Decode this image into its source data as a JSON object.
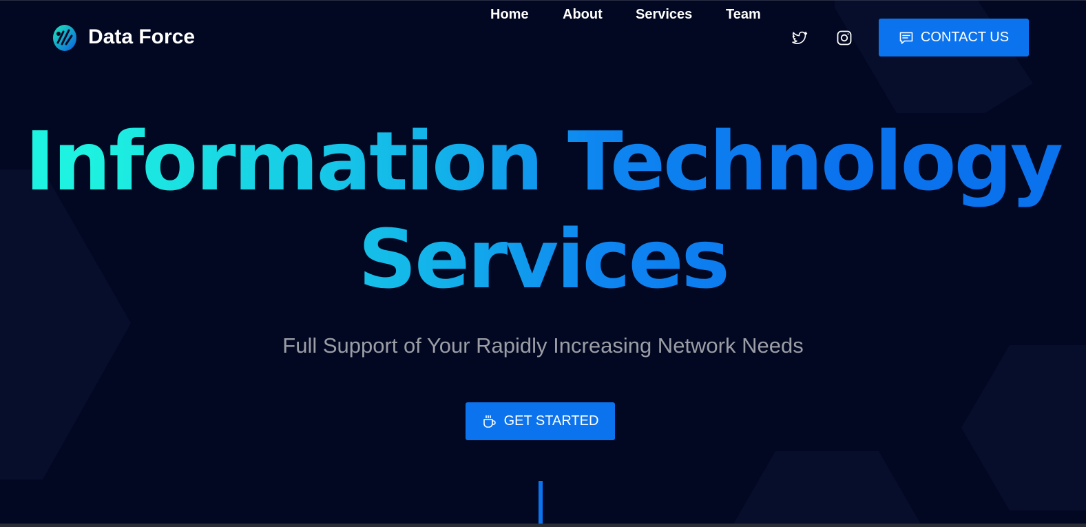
{
  "brand": {
    "name": "Data Force"
  },
  "nav": {
    "home": "Home",
    "about": "About",
    "services": "Services",
    "team": "Team"
  },
  "social": {
    "twitter_icon": "twitter-icon",
    "instagram_icon": "instagram-icon"
  },
  "header": {
    "contact_label": "CONTACT US",
    "contact_icon": "chat-icon"
  },
  "hero": {
    "title_line1": "Information Technology",
    "title_line2": "Services",
    "subtitle": "Full Support of Your Rapidly Increasing Network Needs",
    "cta_label": "GET STARTED",
    "cta_icon": "coffee-cup-icon"
  },
  "colors": {
    "background": "#030822",
    "accent": "#0b73ee",
    "gradient_start": "#1ef2e0",
    "gradient_end": "#0b72ee",
    "subtitle": "#9c9ea6"
  }
}
